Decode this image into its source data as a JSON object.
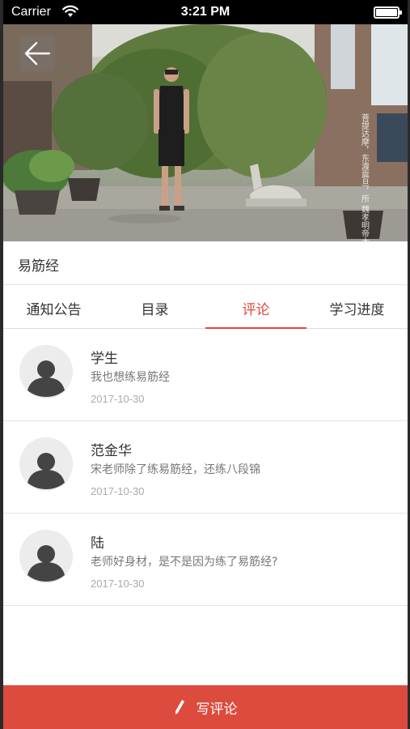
{
  "status_bar": {
    "carrier": "Carrier",
    "time": "3:21 PM"
  },
  "hero": {
    "icon": "back-arrow-icon",
    "overlay_text": "菩提达摩，东渡震旦，所 魏孝明帝太和年间，面壁 于少林寺，留藏经二篇 曰《洗髓经》，一曰《易 筋经》"
  },
  "course": {
    "title": "易筋经"
  },
  "tabs": [
    {
      "label": "通知公告",
      "active": false
    },
    {
      "label": "目录",
      "active": false
    },
    {
      "label": "评论",
      "active": true
    },
    {
      "label": "学习进度",
      "active": false
    }
  ],
  "comments": [
    {
      "author": "学生",
      "text": "我也想练易筋经",
      "date": "2017-10-30"
    },
    {
      "author": "范金华",
      "text": "宋老师除了练易筋经，还练八段锦",
      "date": "2017-10-30"
    },
    {
      "author": "陆",
      "text": "老师好身材，是不是因为练了易筋经?",
      "date": "2017-10-30"
    }
  ],
  "footer": {
    "write_comment_label": "写评论",
    "icon": "pencil-icon"
  },
  "colors": {
    "accent": "#e0483a",
    "button_bg": "#dd4b3e"
  }
}
